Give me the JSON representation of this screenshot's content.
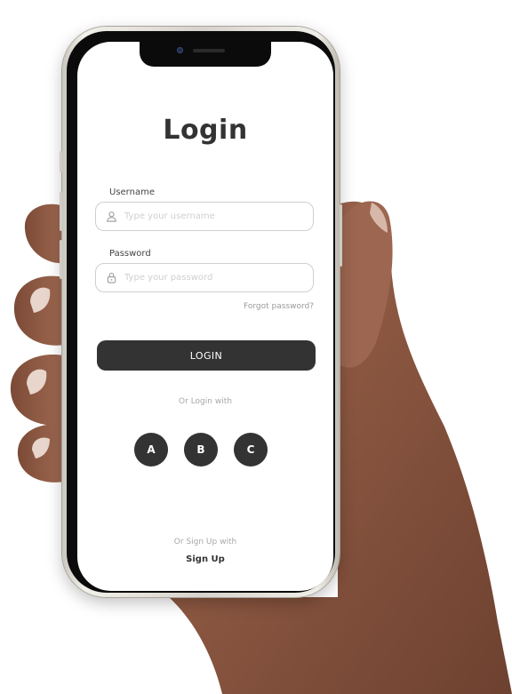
{
  "login": {
    "title": "Login",
    "username": {
      "label": "Username",
      "placeholder": "Type your username",
      "value": "",
      "icon": "user-icon"
    },
    "password": {
      "label": "Password",
      "placeholder": "Type your password",
      "value": "",
      "icon": "lock-icon"
    },
    "forgot_password": "Forgot password?",
    "submit_label": "LOGIN",
    "alt_login_text": "Or Login with",
    "social_buttons": [
      "A",
      "B",
      "C"
    ],
    "signup_prompt": "Or Sign Up with",
    "signup_label": "Sign Up"
  },
  "colors": {
    "primary": "#333333",
    "muted_text": "#a8a8a8",
    "placeholder": "#d0d0d0",
    "field_border": "#cfcfcf",
    "screen_bg": "#ffffff"
  }
}
